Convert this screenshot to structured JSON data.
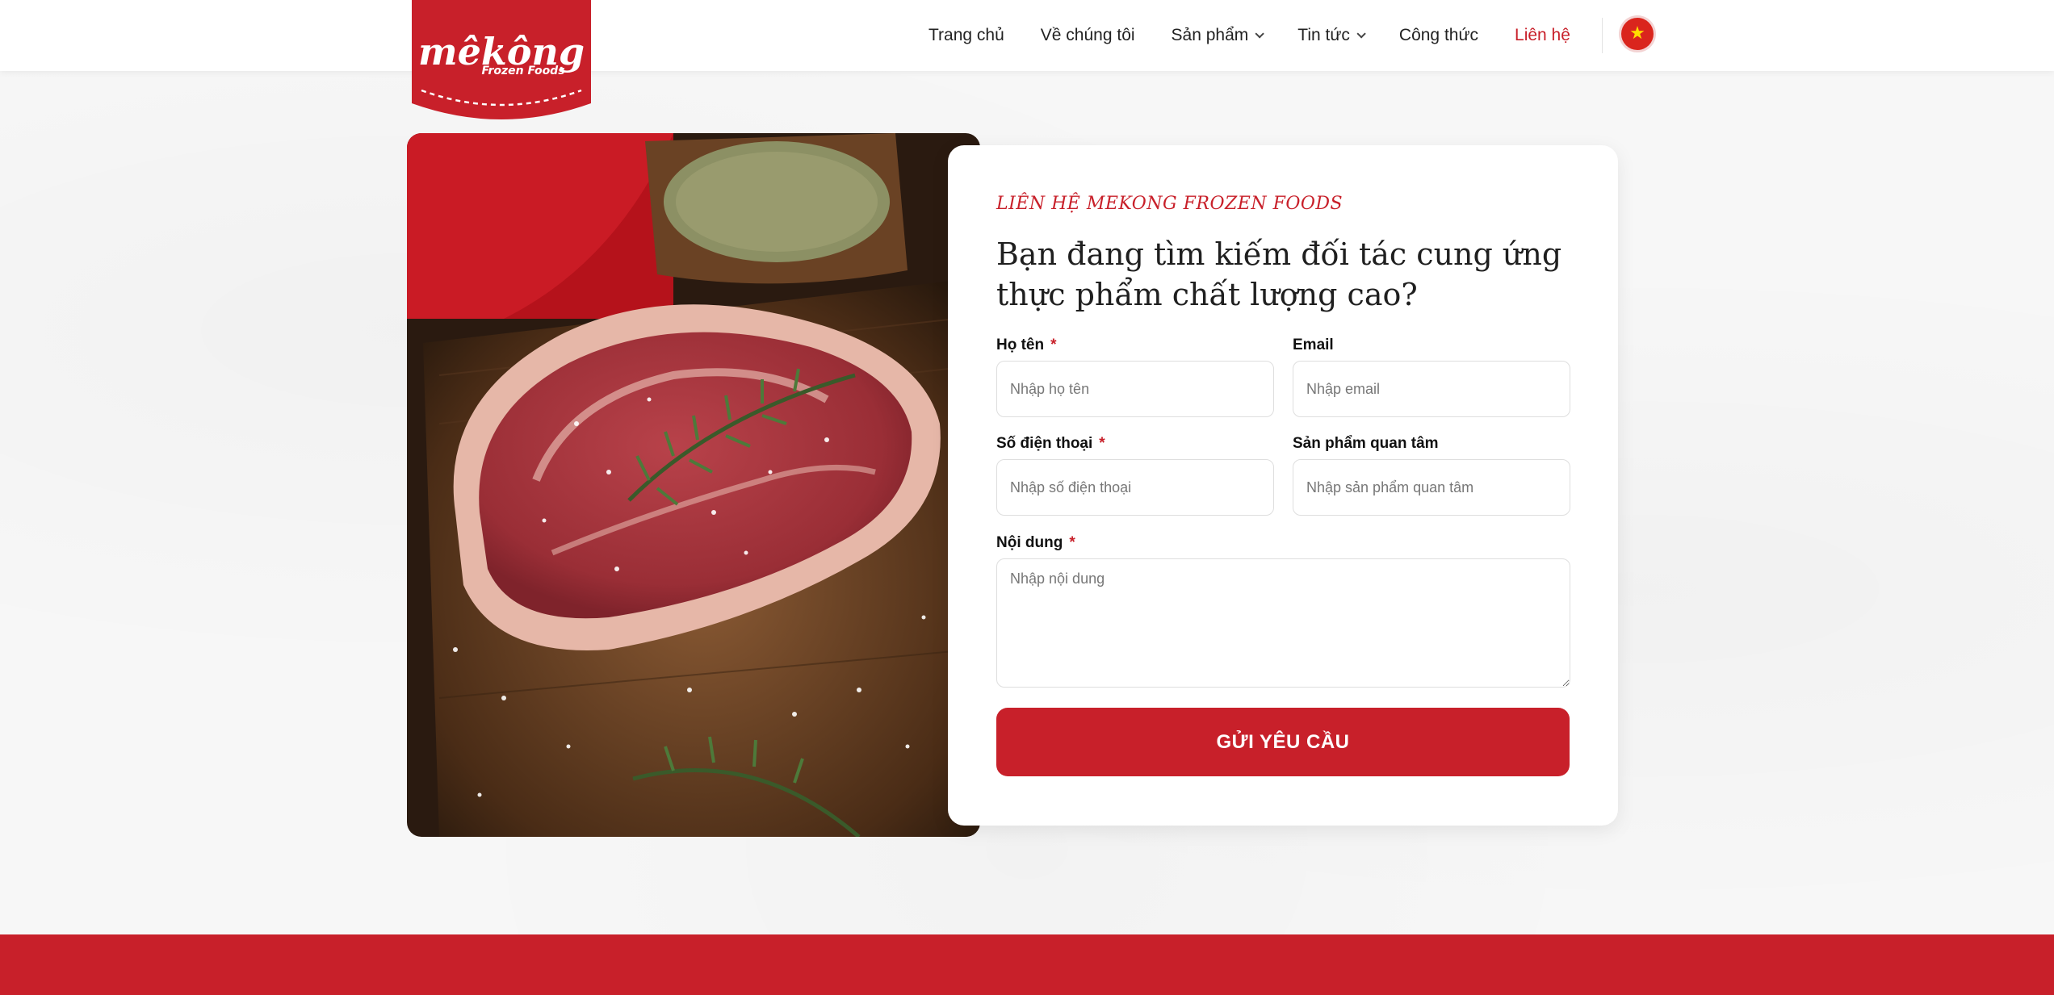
{
  "brand": {
    "logo_name": "Mêkông",
    "logo_tagline": "Frozen Foods",
    "accent_color": "#c8202a"
  },
  "nav": {
    "items": [
      {
        "label": "Trang chủ",
        "has_dropdown": false,
        "active": false
      },
      {
        "label": "Về chúng tôi",
        "has_dropdown": false,
        "active": false
      },
      {
        "label": "Sản phẩm",
        "has_dropdown": true,
        "active": false
      },
      {
        "label": "Tin tức",
        "has_dropdown": true,
        "active": false
      },
      {
        "label": "Công thức",
        "has_dropdown": false,
        "active": false
      },
      {
        "label": "Liên hệ",
        "has_dropdown": false,
        "active": true
      }
    ],
    "language_icon": "vietnam-flag-icon"
  },
  "contact": {
    "eyebrow": "LIÊN HỆ MEKONG FROZEN FOODS",
    "headline": "Bạn đang tìm kiếm đối tác cung ứng thực phẩm chất lượng cao?",
    "fields": {
      "name": {
        "label": "Họ tên",
        "required": "*",
        "placeholder": "Nhập họ tên",
        "value": ""
      },
      "email": {
        "label": "Email",
        "placeholder": "Nhập email",
        "value": ""
      },
      "phone": {
        "label": "Số điện thoại",
        "required": "*",
        "placeholder": "Nhập số điện thoại",
        "value": ""
      },
      "product": {
        "label": "Sản phẩm quan tâm",
        "placeholder": "Nhập sản phẩm quan tâm",
        "value": ""
      },
      "message": {
        "label": "Nội dung",
        "required": "*",
        "placeholder": "Nhập nội dung",
        "value": ""
      }
    },
    "submit_label": "GỬI YÊU CẦU"
  }
}
